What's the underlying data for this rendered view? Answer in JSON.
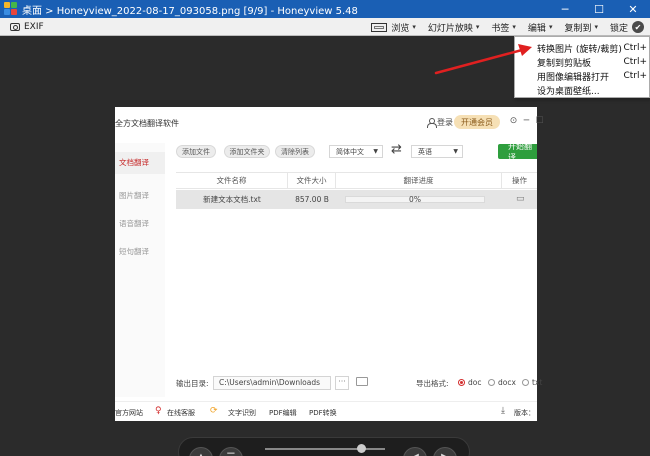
{
  "window": {
    "title": "桌面 > Honeyview_2022-08-17_093058.png [9/9] - Honeyview 5.48",
    "minimize": "─",
    "maximize": "☐",
    "close": "✕"
  },
  "toolbar": {
    "exif": "EXIF",
    "browse": "浏览",
    "slideshow": "幻灯片放映",
    "bookmarks": "书签",
    "edit": "编辑",
    "copy_to": "复制到",
    "lock": "锁定",
    "caret": "▾"
  },
  "edit_menu": {
    "items": [
      {
        "label": "转换图片 (旋转/裁剪)",
        "shortcut": "Ctrl+"
      },
      {
        "label": "复制到剪贴板",
        "shortcut": "Ctrl+"
      },
      {
        "label": "用图像编辑器打开",
        "shortcut": "Ctrl+"
      },
      {
        "label": "设为桌面壁纸...",
        "shortcut": ""
      }
    ]
  },
  "annotation_color": "#e02020",
  "image": {
    "app_title": "全方文档翻译软件",
    "login": "登录",
    "vip": "开通会员",
    "controls": [
      "⊙",
      "─",
      "☐"
    ],
    "sidebar": [
      "文档翻译",
      "图片翻译",
      "语音翻译",
      "短句翻译"
    ],
    "toolbar_buttons": [
      "添加文件",
      "添加文件夹",
      "清除列表"
    ],
    "source_lang": "简体中文",
    "target_lang": "英语",
    "swap": "⇄",
    "start_button": "开始翻译",
    "columns": [
      "文件名称",
      "文件大小",
      "翻译进度",
      "操作"
    ],
    "rows": [
      {
        "name": "新建文本文档.txt",
        "size": "857.00 B",
        "progress_text": "0%",
        "progress": 0.0
      }
    ],
    "output_label": "输出目录:",
    "output_path": "C:\\Users\\admin\\Downloads",
    "browse_btn": "···",
    "format_label": "导出格式:",
    "formats": [
      {
        "label": "doc",
        "checked": true
      },
      {
        "label": "docx",
        "checked": false
      },
      {
        "label": "txt",
        "checked": false
      }
    ],
    "footer": {
      "website": "官方网站",
      "support": "在线客服",
      "ocr": "文字识别",
      "pdf_edit": "PDF编辑",
      "pdf_convert": "PDF转换",
      "version": "版本："
    },
    "accent_green": "#2e9e3d",
    "accent_red": "#c62828"
  },
  "navbar": {
    "buttons": [
      "▲",
      "☰",
      "◀",
      "▶"
    ],
    "position": 0.8
  }
}
